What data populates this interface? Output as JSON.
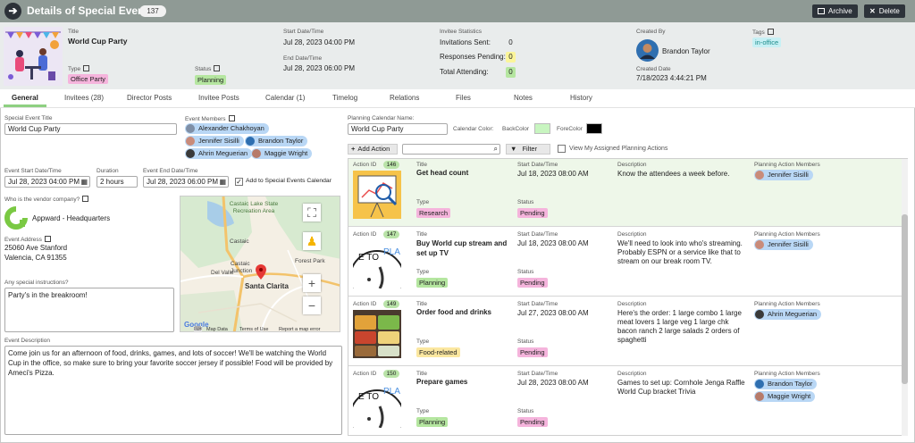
{
  "header": {
    "title": "Details of Special Event",
    "count": "137",
    "archive_label": "Archive",
    "delete_label": "Delete"
  },
  "summary": {
    "title_label": "Title",
    "title_value": "World Cup Party",
    "type_label": "Type",
    "type_value": "Office Party",
    "status_label": "Status",
    "status_value": "Planning",
    "start_label": "Start Date/Time",
    "start_value": "Jul 28, 2023 04:00 PM",
    "end_label": "End Date/Time",
    "end_value": "Jul 28, 2023 06:00 PM",
    "stats_label": "Invitee Statistics",
    "invitations_label": "Invitations Sent:",
    "invitations_value": "0",
    "responses_label": "Responses Pending:",
    "responses_value": "0",
    "attending_label": "Total Attending:",
    "attending_value": "0",
    "created_by_label": "Created By",
    "created_by_value": "Brandon Taylor",
    "created_date_label": "Created Date",
    "created_date_value": "7/18/2023 4:44:21 PM",
    "tags_label": "Tags",
    "tags_value": "in-office"
  },
  "tabs": [
    {
      "label": "General"
    },
    {
      "label": "Invitees (28)"
    },
    {
      "label": "Director Posts"
    },
    {
      "label": "Invitee Posts"
    },
    {
      "label": "Calendar (1)"
    },
    {
      "label": "Timelog"
    },
    {
      "label": "Relations"
    },
    {
      "label": "Files"
    },
    {
      "label": "Notes"
    },
    {
      "label": "History"
    }
  ],
  "form": {
    "event_title_label": "Special Event Title",
    "event_title_value": "World Cup Party",
    "members_label": "Event Members",
    "members": [
      "Alexander Chakhoyan",
      "Jennifer Sisilli",
      "Brandon Taylor",
      "Ahrin Meguerian",
      "Maggie Wright"
    ],
    "start_label": "Event Start Date/Time",
    "start_value": "Jul 28, 2023 04:00 PM",
    "duration_label": "Duration",
    "duration_value": "2 hours",
    "end_label": "Event End Date/Time",
    "end_value": "Jul 28, 2023 06:00 PM",
    "add_calendar_label": "Add to Special Events Calendar",
    "vendor_label": "Who is the vendor company?",
    "vendor_value": "Appward - Headquarters",
    "address_label": "Event Address",
    "address_line1": "25060 Ave Stanford",
    "address_line2": "Valencia, CA 91355",
    "instructions_label": "Any special instructions?",
    "instructions_value": "Party's in the breakroom!",
    "description_label": "Event Description",
    "description_value": "Come join us for an afternoon of food, drinks, games, and lots of soccer! We'll be watching the World Cup in the office, so make sure to bring your favorite soccer jersey if possible! Food will be provided by Ameci's Pizza."
  },
  "map": {
    "labels": [
      "Castaic Lake State Recreation Area",
      "Castaic",
      "Castaic Junction",
      "Del Valle",
      "Forest Park",
      "Santa Clarita"
    ],
    "footer_google": "Google",
    "footer_data": "Map Data",
    "footer_terms": "Terms of Use",
    "footer_report": "Report a map error",
    "zoom_in": "+",
    "zoom_out": "−"
  },
  "planning": {
    "calendar_label": "Planning Calendar Name:",
    "calendar_value": "World Cup Party",
    "color_label": "Calendar Color:",
    "back_label": "BackColor",
    "fore_label": "ForeColor",
    "back_color": "#c8f5c0",
    "fore_color": "#000000",
    "add_action_label": "Add Action",
    "search_placeholder": "",
    "filter_label": "Filter",
    "my_actions_label": "View My Assigned Planning Actions",
    "col_id": "Action ID",
    "col_title": "Title",
    "col_start": "Start Date/Time",
    "col_desc": "Description",
    "col_members": "Planning Action Members",
    "col_type": "Type",
    "col_status": "Status",
    "actions": [
      {
        "id": "146",
        "title": "Get head count",
        "start": "Jul 18, 2023 08:00 AM",
        "desc": "Know the attendees a week before.",
        "type": "Research",
        "status": "Pending",
        "members": [
          "Jennifer Sisilli"
        ]
      },
      {
        "id": "147",
        "title": "Buy World cup stream and set up TV",
        "start": "Jul 18, 2023 08:00 AM",
        "desc": "We'll need to look into who's streaming. Probably ESPN or a service like that to stream on our break room TV.",
        "type": "Planning",
        "status": "Pending",
        "members": [
          "Jennifer Sisilli"
        ]
      },
      {
        "id": "149",
        "title": "Order food and drinks",
        "start": "Jul 27, 2023 08:00 AM",
        "desc": "Here's the order: 1 large combo 1 large meat lovers 1 large veg 1 large chk bacon ranch 2 large salads 2 orders of spaghetti",
        "type": "Food-related",
        "status": "Pending",
        "members": [
          "Ahrin Meguerian"
        ]
      },
      {
        "id": "150",
        "title": "Prepare games",
        "start": "Jul 28, 2023 08:00 AM",
        "desc": "Games to set up: Cornhole Jenga Raffle World Cup bracket Trivia",
        "type": "Planning",
        "status": "Pending",
        "members": [
          "Brandon Taylor",
          "Maggie Wright"
        ]
      }
    ]
  },
  "colors": {
    "header_bg": "#8f9a95",
    "accent_green": "#8ed081",
    "chip_blue": "#b9d7f5",
    "type_pink": "#f5b4dc",
    "status_green": "#b5e6a0"
  }
}
